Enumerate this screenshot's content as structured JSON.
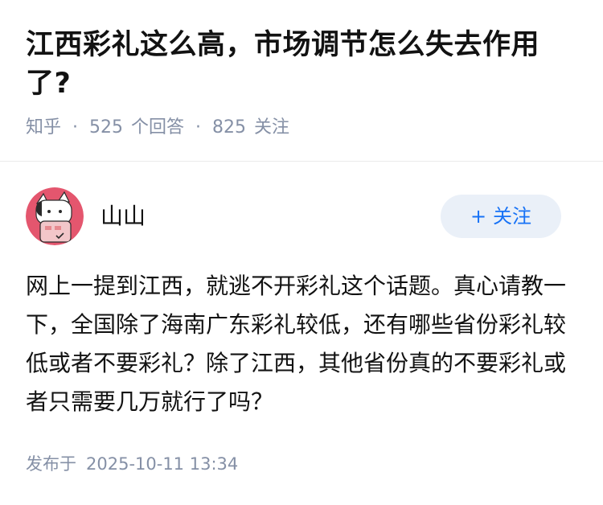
{
  "question": {
    "title": "江西彩礼这么高，市场调节怎么失去作用了?",
    "source": "知乎",
    "separator": "·",
    "answer_count": "525",
    "answer_count_label": "个回答",
    "follower_count": "825",
    "follower_label": "关注"
  },
  "answer": {
    "author": {
      "name": "山山",
      "avatar_icon": "cartoon-cat-avatar-icon",
      "follow_icon": "plus-icon",
      "follow_plus": "+",
      "follow_label": "关注"
    },
    "content": "网上一提到江西，就逃不开彩礼这个话题。真心请教一下，全国除了海南广东彩礼较低，还有哪些省份彩礼较低或者不要彩礼？除了江西，其他省份真的不要彩礼或者只需要几万就行了吗？",
    "published_label": "发布于",
    "published_time": "2025-10-11 13:34"
  },
  "colors": {
    "title": "#121212",
    "meta": "#8590a6",
    "follow_text": "#1772f6",
    "follow_bg": "#eaf0f8",
    "avatar_bg": "#e4566e",
    "divider": "#ebebeb"
  }
}
